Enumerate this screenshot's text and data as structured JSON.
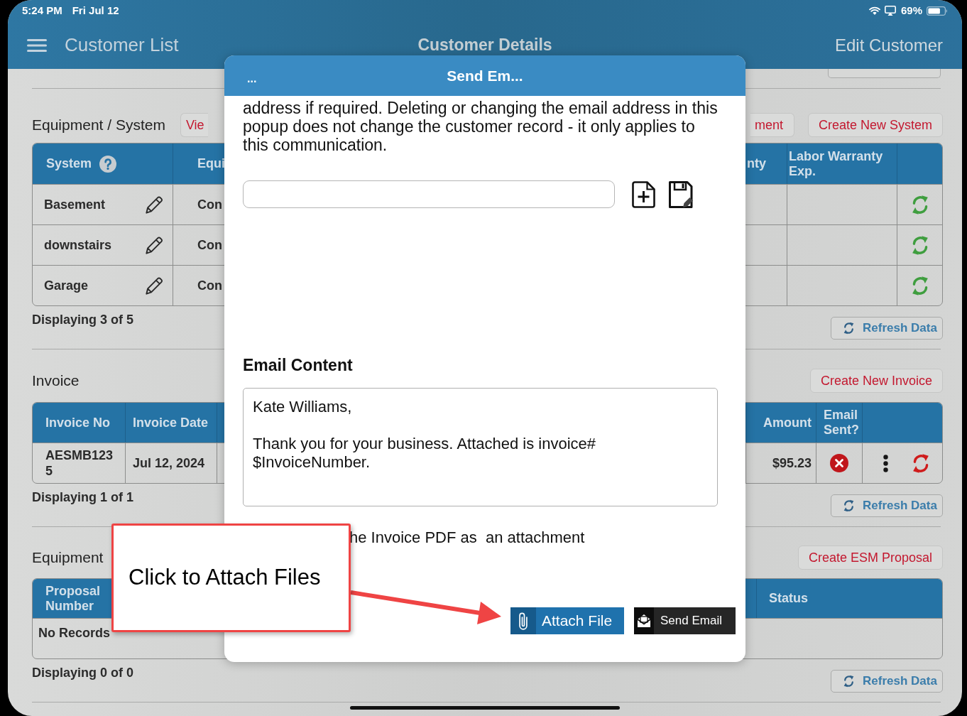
{
  "status_bar": {
    "time": "5:24 PM",
    "date": "Fri Jul 12",
    "battery": "69%"
  },
  "nav_bar": {
    "back": "Customer List",
    "title": "Customer Details",
    "action": "Edit Customer"
  },
  "sections": [
    {
      "kind": "systems",
      "title": "Equipment / System",
      "left_buttons": [
        "Vie"
      ],
      "right_buttons": [
        "ment",
        "Create New System"
      ],
      "table": {
        "columns": [
          "System",
          "Equi",
          "nty",
          "Labor Warranty Exp."
        ],
        "rows": [
          {
            "system": "Basement",
            "column_2": "Con"
          },
          {
            "system": "downstairs",
            "column_2": "Con"
          },
          {
            "system": "Garage",
            "column_2": "Con"
          }
        ]
      },
      "footer": "Displaying 3 of 5",
      "refresh_button": "Refresh Data"
    },
    {
      "kind": "invoices",
      "title": "Invoice",
      "right_buttons": [
        "Create New Invoice"
      ],
      "table": {
        "columns": [
          "Invoice No",
          "Invoice Date",
          "Amount",
          "Email Sent?"
        ],
        "rows": [
          {
            "invoice_no": "AESMB1235",
            "invoice_date": "Jul 12, 2024",
            "amount": "$95.23",
            "email_sent": false
          }
        ]
      },
      "footer": "Displaying 1 of 1",
      "refresh_button": "Refresh Data"
    },
    {
      "kind": "proposals",
      "title": "Equipment",
      "right_buttons": [
        "Create ESM Proposal"
      ],
      "table": {
        "columns": [
          "Proposal Number",
          "Status"
        ],
        "empty_message": "No Records"
      },
      "footer": "Displaying 0 of 0",
      "refresh_button": "Refresh Data"
    }
  ],
  "modal": {
    "menu": "...",
    "title": "Send Em...",
    "description": "address if required. Deleting or changing the email address in this popup does not change the customer record - it only applies to this communication.",
    "content_label": "Email Content",
    "content": "Kate Williams,\n\nThank you for your business. Attached is invoice# $InvoiceNumber.",
    "attachment_note": "he Invoice PDF as  an attachment",
    "buttons": [
      {
        "kind": "attach",
        "label": "Attach File"
      },
      {
        "kind": "send",
        "label": "Send Email"
      }
    ]
  },
  "callout": {
    "text": "Click to Attach Files"
  }
}
